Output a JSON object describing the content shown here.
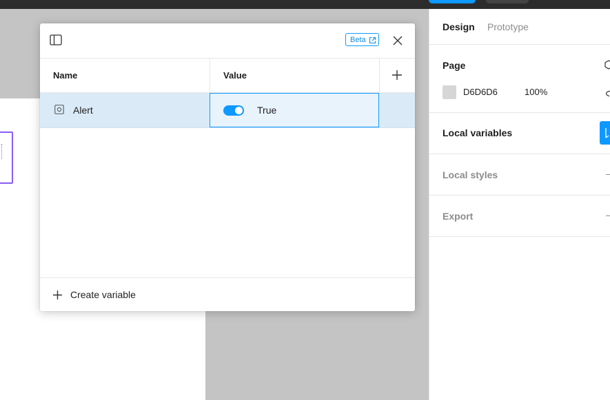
{
  "modal": {
    "beta_label": "Beta",
    "columns": {
      "name": "Name",
      "value": "Value"
    },
    "rows": [
      {
        "name": "Alert",
        "value_label": "True",
        "toggle_on": true
      }
    ],
    "create_variable_label": "Create variable"
  },
  "panel": {
    "tabs": {
      "design": "Design",
      "prototype": "Prototype"
    },
    "page": {
      "title": "Page",
      "color_hex": "D6D6D6",
      "opacity": "100%"
    },
    "sections": {
      "local_variables": "Local variables",
      "local_styles": "Local styles",
      "export": "Export"
    }
  },
  "colors": {
    "accent": "#0d99ff",
    "selected_row": "#daebf7",
    "selection_frame": "#8a5cf6",
    "page_swatch": "#d6d6d6"
  },
  "icons": {
    "sidebar_toggle": "sidebar-toggle-icon",
    "external_link": "external-link-icon",
    "close": "close-icon",
    "add": "plus-icon",
    "boolean_variable": "boolean-variable-icon",
    "eye": "eye-icon",
    "page_settings": "hexagon-icon",
    "open_variables": "variables-icon"
  }
}
